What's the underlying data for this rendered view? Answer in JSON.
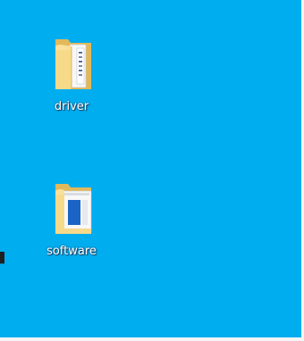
{
  "desktop": {
    "background_color": "#00adef",
    "icons": [
      {
        "label": "driver",
        "icon": "folder-icon-with-documents"
      },
      {
        "label": "software",
        "icon": "folder-icon-with-window-preview"
      }
    ]
  }
}
